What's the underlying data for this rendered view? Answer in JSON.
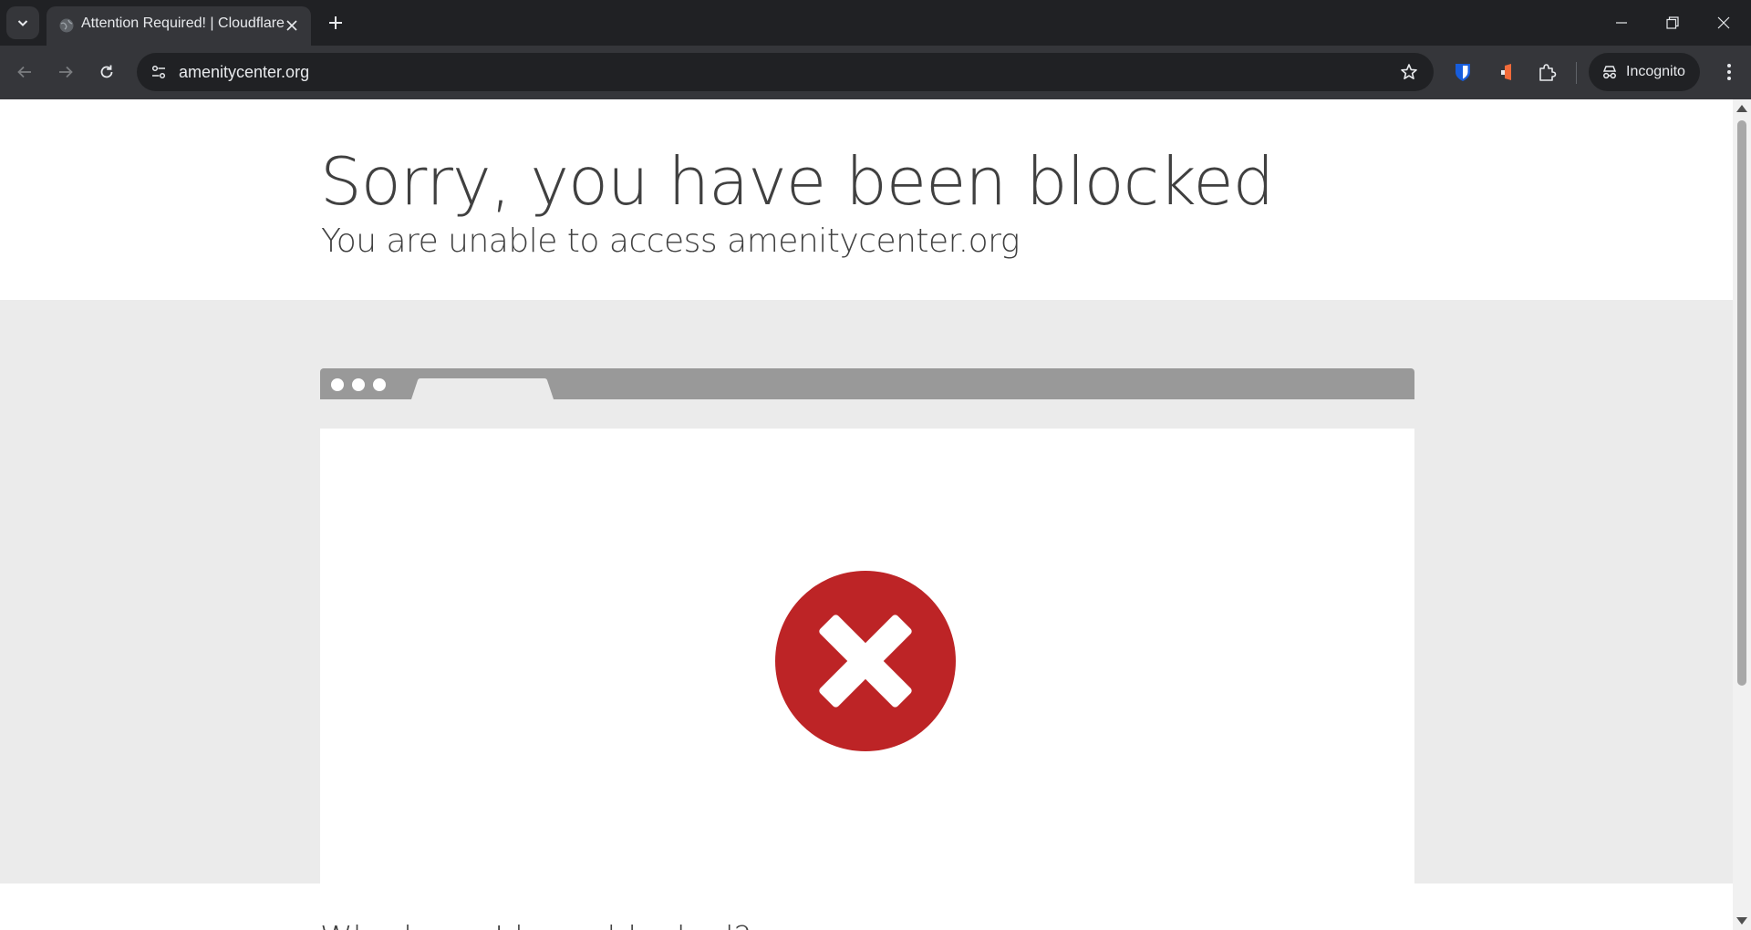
{
  "browser": {
    "tab_title": "Attention Required! | Cloudflare",
    "url": "amenitycenter.org",
    "profile_label": "Incognito"
  },
  "page": {
    "headline": "Sorry, you have been blocked",
    "subheadline": "You are unable to access amenitycenter.org",
    "partial_next_heading": "Why have I been blocked?"
  },
  "icons": {
    "tab_search": "chevron-down-icon",
    "favicon": "globe-icon",
    "tab_close": "close-icon",
    "new_tab": "plus-icon",
    "back": "arrow-left-icon",
    "forward": "arrow-right-icon",
    "reload": "reload-icon",
    "site_info": "tune-icon",
    "bookmark": "star-icon",
    "extension_1": "bitwarden-shield-icon",
    "extension_2": "orange-extension-icon",
    "extensions": "puzzle-icon",
    "incognito": "incognito-icon",
    "menu": "kebab-menu-icon",
    "error": "error-x-icon"
  },
  "colors": {
    "error_red": "#bd2426",
    "chrome_dark": "#202124",
    "chrome_toolbar": "#35363a",
    "band_gray": "#ebebeb",
    "mock_browser_bar": "#999999"
  }
}
